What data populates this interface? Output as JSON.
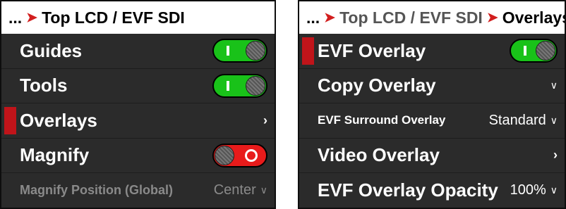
{
  "left_panel": {
    "breadcrumb": {
      "dots": "...",
      "current": "Top LCD / EVF SDI"
    },
    "rows": [
      {
        "label": "Guides",
        "toggle": "on"
      },
      {
        "label": "Tools",
        "toggle": "on"
      },
      {
        "label": "Overlays",
        "chevron": "›",
        "selected": true
      },
      {
        "label": "Magnify",
        "toggle": "off"
      },
      {
        "label": "Magnify Position (Global)",
        "value": "Center",
        "disabled": true
      }
    ]
  },
  "right_panel": {
    "breadcrumb": {
      "dots": "...",
      "previous": "Top LCD / EVF SDI",
      "current": "Overlays"
    },
    "rows": [
      {
        "label": "EVF Overlay",
        "toggle": "on",
        "selected": true
      },
      {
        "label": "Copy Overlay",
        "chevron_down": "∨"
      },
      {
        "label": "EVF Surround Overlay",
        "value": "Standard"
      },
      {
        "label": "Video Overlay",
        "chevron": "›"
      },
      {
        "label": "EVF Overlay Opacity",
        "value": "100%"
      }
    ]
  },
  "glyphs": {
    "separator": "➤",
    "dropdown": "∨",
    "chevron": "›"
  },
  "colors": {
    "accent_red": "#c0141a",
    "toggle_on": "#19c219",
    "toggle_off": "#e81b1b",
    "row_bg": "#2b2b2b"
  }
}
